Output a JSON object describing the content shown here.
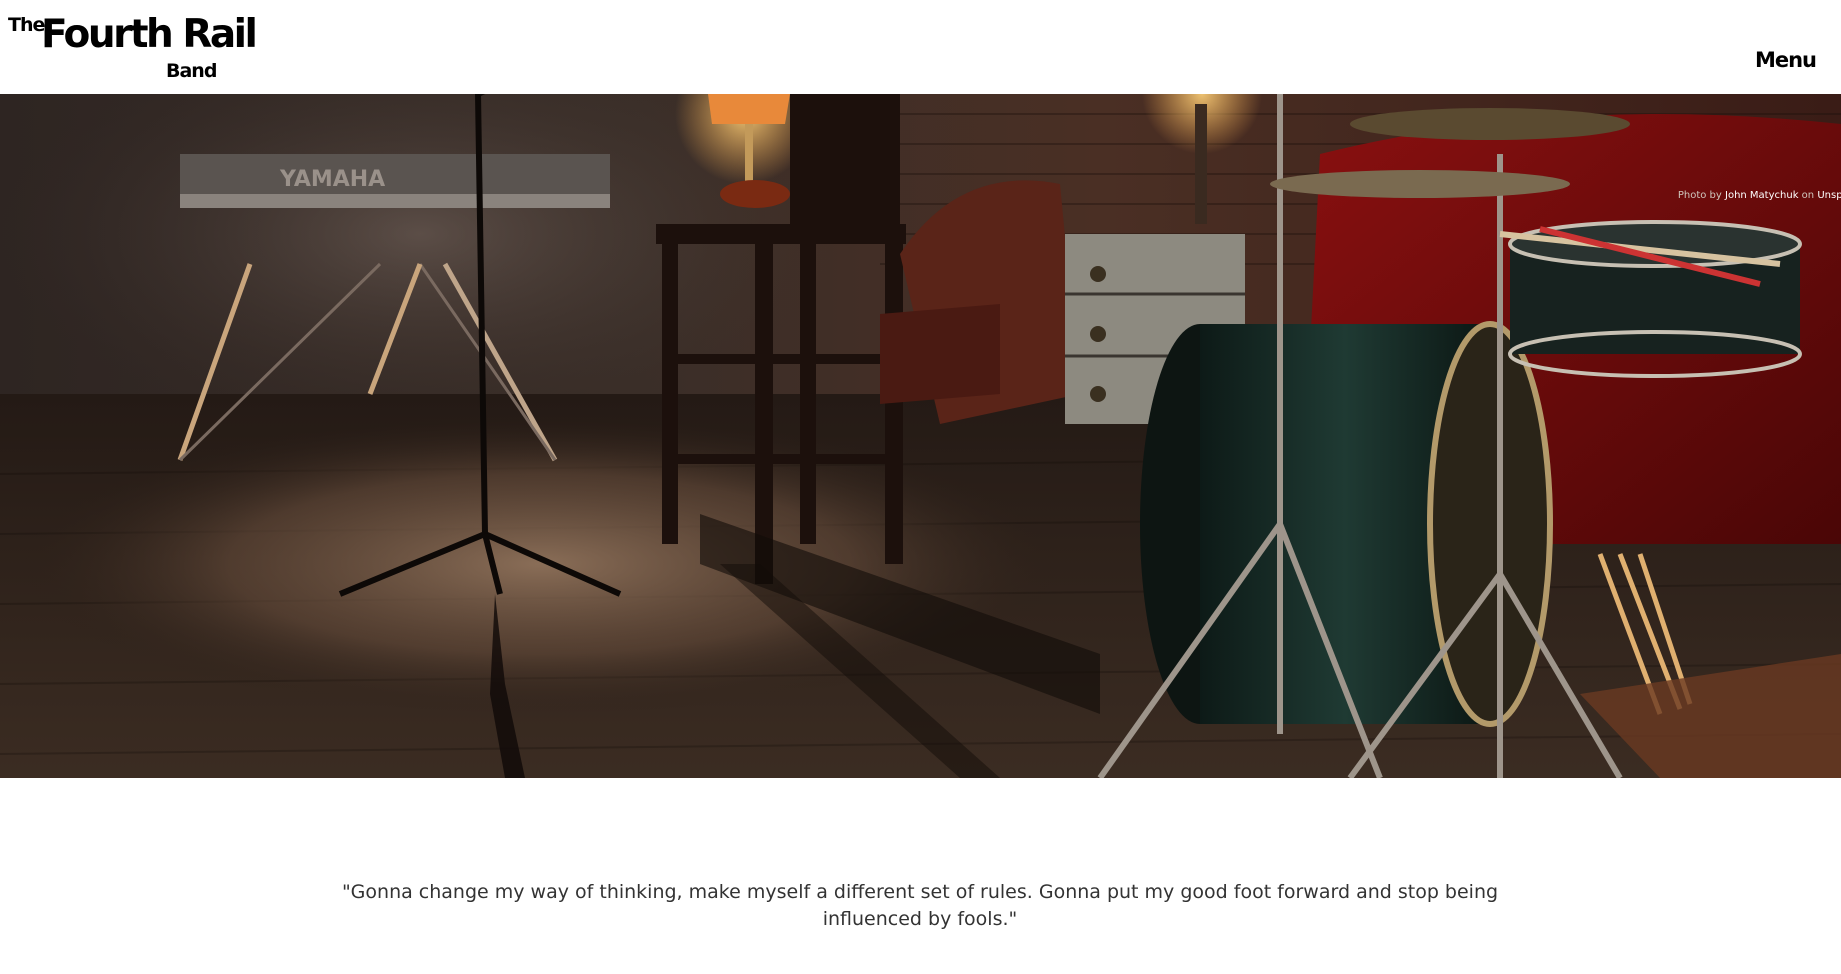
{
  "brand": {
    "the": "The",
    "name": "Fourth Rail",
    "band": "Band"
  },
  "nav": {
    "menu_label": "Menu"
  },
  "hero": {
    "credit_prefix": "Photo by",
    "credit_author": "John Matychuk",
    "credit_on": "on",
    "credit_site": "Unsplash",
    "keyboard_brand": "YAMAHA"
  },
  "quote": {
    "text": "\"Gonna change my way of thinking, make myself a different set of rules. Gonna put my good foot forward and stop being influenced by fools.\""
  },
  "colors": {
    "text": "#333333",
    "brand": "#000000",
    "background": "#ffffff"
  }
}
